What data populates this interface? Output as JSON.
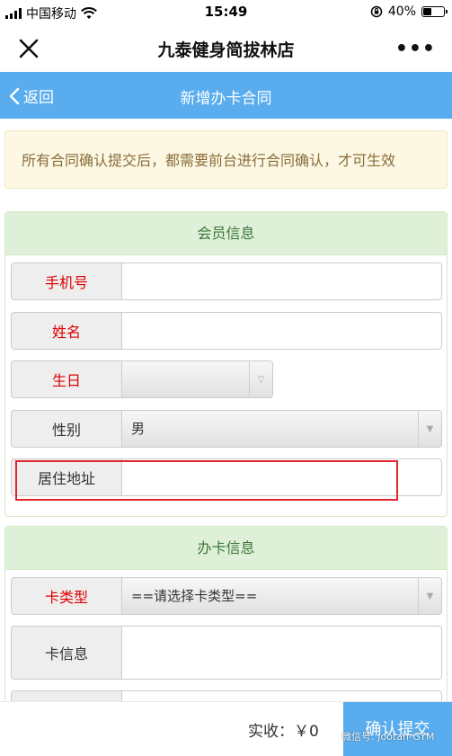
{
  "status_bar": {
    "carrier": "中国移动",
    "time": "15:49",
    "battery": "40%",
    "battery_level": 0.4
  },
  "title_bar": {
    "title": "九泰健身简拔林店",
    "more": "•••"
  },
  "nav": {
    "back_label": "返回",
    "title": "新增办卡合同"
  },
  "notice": "所有合同确认提交后，都需要前台进行合同确认，才可生效",
  "member_section": {
    "title": "会员信息",
    "fields": {
      "phone": {
        "label": "手机号",
        "value": "",
        "required": true
      },
      "name": {
        "label": "姓名",
        "value": "",
        "required": true
      },
      "birthday": {
        "label": "生日",
        "value": "",
        "required": true
      },
      "gender": {
        "label": "性别",
        "value": "男",
        "required": false
      },
      "address": {
        "label": "居住地址",
        "value": "",
        "required": false
      }
    }
  },
  "card_section": {
    "title": "办卡信息",
    "fields": {
      "card_type": {
        "label": "卡类型",
        "value": "==请选择卡类型==",
        "required": true
      },
      "card_info": {
        "label": "卡信息",
        "value": "",
        "required": false
      }
    }
  },
  "footer": {
    "total_label": "实收：￥0",
    "submit_label": "确认提交"
  },
  "watermark": "微信号: Jootan-GYM",
  "colors": {
    "primary": "#59adee",
    "required": "#e00000",
    "highlight": "#e3262b",
    "panel_head": "#dff0d8",
    "notice_bg": "#fcf8e3"
  }
}
